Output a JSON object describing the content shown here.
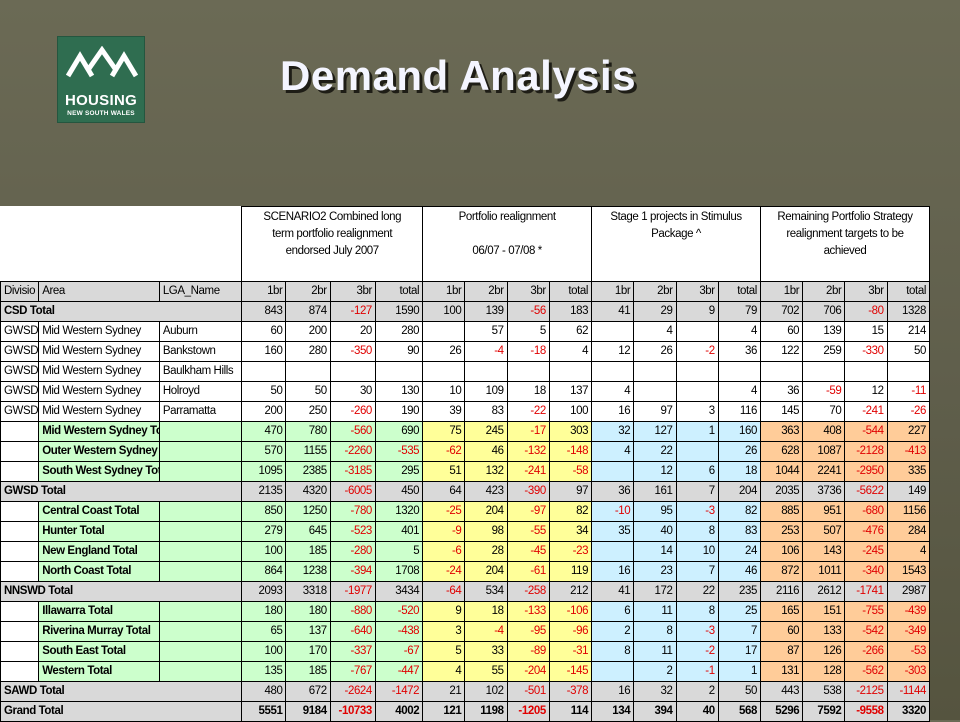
{
  "title": "Demand Analysis",
  "logo": {
    "line1": "HOUSING",
    "line2": "NEW SOUTH WALES",
    "icon": "mountain-roofs-icon",
    "color": "#2f6d50"
  },
  "table": {
    "group_headers": [
      "SCENARIO2        Combined long term portfolio realignment endorsed July 2007",
      "Portfolio realignment\n\n06/07 - 07/08 *",
      "Stage 1 projects in Stimulus Package ^",
      "Remaining Portfolio Strategy realignment targets to be achieved"
    ],
    "columns": [
      "Divisio",
      "Area",
      "LGA_Name",
      "1br",
      "2br",
      "3br",
      "total",
      "1br",
      "2br",
      "3br",
      "total",
      "1br",
      "2br",
      "3br",
      "total",
      "1br",
      "2br",
      "3br",
      "total"
    ],
    "rows": [
      {
        "style": "total",
        "div": "CSD Total",
        "area": "",
        "lga": "",
        "v": [
          "843",
          "874",
          "-127",
          "1590",
          "100",
          "139",
          "-56",
          "183",
          "41",
          "29",
          "9",
          "79",
          "702",
          "706",
          "-80",
          "1328"
        ]
      },
      {
        "style": "detail",
        "div": "GWSD",
        "area": "Mid Western Sydney",
        "lga": "Auburn",
        "v": [
          "60",
          "200",
          "20",
          "280",
          "",
          "57",
          "5",
          "62",
          "",
          "4",
          "",
          "4",
          "60",
          "139",
          "15",
          "214"
        ]
      },
      {
        "style": "detail",
        "div": "GWSD",
        "area": "Mid Western Sydney",
        "lga": "Bankstown",
        "v": [
          "160",
          "280",
          "-350",
          "90",
          "26",
          "-4",
          "-18",
          "4",
          "12",
          "26",
          "-2",
          "36",
          "122",
          "259",
          "-330",
          "50"
        ]
      },
      {
        "style": "detail",
        "div": "GWSD",
        "area": "Mid Western Sydney",
        "lga": "Baulkham Hills",
        "v": [
          "",
          "",
          "",
          "",
          "",
          "",
          "",
          "",
          "",
          "",
          "",
          "",
          "",
          "",
          "",
          ""
        ]
      },
      {
        "style": "detail",
        "div": "GWSD",
        "area": "Mid Western Sydney",
        "lga": "Holroyd",
        "v": [
          "50",
          "50",
          "30",
          "130",
          "10",
          "109",
          "18",
          "137",
          "4",
          "",
          "",
          "4",
          "36",
          "-59",
          "12",
          "-11"
        ]
      },
      {
        "style": "detail",
        "div": "GWSD",
        "area": "Mid Western Sydney",
        "lga": "Parramatta",
        "v": [
          "200",
          "250",
          "-260",
          "190",
          "39",
          "83",
          "-22",
          "100",
          "16",
          "97",
          "3",
          "116",
          "145",
          "70",
          "-241",
          "-26"
        ]
      },
      {
        "style": "area",
        "div": "",
        "area": "Mid Western Sydney Total",
        "lga": "",
        "v": [
          "470",
          "780",
          "-560",
          "690",
          "75",
          "245",
          "-17",
          "303",
          "32",
          "127",
          "1",
          "160",
          "363",
          "408",
          "-544",
          "227"
        ]
      },
      {
        "style": "area",
        "div": "",
        "area": "Outer Western Sydney Total",
        "lga": "",
        "v": [
          "570",
          "1155",
          "-2260",
          "-535",
          "-62",
          "46",
          "-132",
          "-148",
          "4",
          "22",
          "",
          "26",
          "628",
          "1087",
          "-2128",
          "-413"
        ]
      },
      {
        "style": "area",
        "div": "",
        "area": "South West Sydney Total",
        "lga": "",
        "v": [
          "1095",
          "2385",
          "-3185",
          "295",
          "51",
          "132",
          "-241",
          "-58",
          "",
          "12",
          "6",
          "18",
          "1044",
          "2241",
          "-2950",
          "335"
        ]
      },
      {
        "style": "total",
        "div": "GWSD Total",
        "area": "",
        "lga": "",
        "v": [
          "2135",
          "4320",
          "-6005",
          "450",
          "64",
          "423",
          "-390",
          "97",
          "36",
          "161",
          "7",
          "204",
          "2035",
          "3736",
          "-5622",
          "149"
        ]
      },
      {
        "style": "area",
        "div": "",
        "area": "Central Coast Total",
        "lga": "",
        "v": [
          "850",
          "1250",
          "-780",
          "1320",
          "-25",
          "204",
          "-97",
          "82",
          "-10",
          "95",
          "-3",
          "82",
          "885",
          "951",
          "-680",
          "1156"
        ]
      },
      {
        "style": "area",
        "div": "",
        "area": "Hunter Total",
        "lga": "",
        "v": [
          "279",
          "645",
          "-523",
          "401",
          "-9",
          "98",
          "-55",
          "34",
          "35",
          "40",
          "8",
          "83",
          "253",
          "507",
          "-476",
          "284"
        ]
      },
      {
        "style": "area",
        "div": "",
        "area": "New England Total",
        "lga": "",
        "v": [
          "100",
          "185",
          "-280",
          "5",
          "-6",
          "28",
          "-45",
          "-23",
          "",
          "14",
          "10",
          "24",
          "106",
          "143",
          "-245",
          "4"
        ]
      },
      {
        "style": "area",
        "div": "",
        "area": "North Coast Total",
        "lga": "",
        "v": [
          "864",
          "1238",
          "-394",
          "1708",
          "-24",
          "204",
          "-61",
          "119",
          "16",
          "23",
          "7",
          "46",
          "872",
          "1011",
          "-340",
          "1543"
        ]
      },
      {
        "style": "total",
        "div": "NNSWD Total",
        "area": "",
        "lga": "",
        "v": [
          "2093",
          "3318",
          "-1977",
          "3434",
          "-64",
          "534",
          "-258",
          "212",
          "41",
          "172",
          "22",
          "235",
          "2116",
          "2612",
          "-1741",
          "2987"
        ]
      },
      {
        "style": "area",
        "div": "",
        "area": "Illawarra Total",
        "lga": "",
        "v": [
          "180",
          "180",
          "-880",
          "-520",
          "9",
          "18",
          "-133",
          "-106",
          "6",
          "11",
          "8",
          "25",
          "165",
          "151",
          "-755",
          "-439"
        ]
      },
      {
        "style": "area",
        "div": "",
        "area": "Riverina Murray Total",
        "lga": "",
        "v": [
          "65",
          "137",
          "-640",
          "-438",
          "3",
          "-4",
          "-95",
          "-96",
          "2",
          "8",
          "-3",
          "7",
          "60",
          "133",
          "-542",
          "-349"
        ]
      },
      {
        "style": "area",
        "div": "",
        "area": "South East Total",
        "lga": "",
        "v": [
          "100",
          "170",
          "-337",
          "-67",
          "5",
          "33",
          "-89",
          "-31",
          "8",
          "11",
          "-2",
          "17",
          "87",
          "126",
          "-266",
          "-53"
        ]
      },
      {
        "style": "area",
        "div": "",
        "area": "Western Total",
        "lga": "",
        "v": [
          "135",
          "185",
          "-767",
          "-447",
          "4",
          "55",
          "-204",
          "-145",
          "",
          "2",
          "-1",
          "1",
          "131",
          "128",
          "-562",
          "-303"
        ]
      },
      {
        "style": "total",
        "div": "SAWD Total",
        "area": "",
        "lga": "",
        "v": [
          "480",
          "672",
          "-2624",
          "-1472",
          "21",
          "102",
          "-501",
          "-378",
          "16",
          "32",
          "2",
          "50",
          "443",
          "538",
          "-2125",
          "-1144"
        ]
      },
      {
        "style": "grand",
        "div": "Grand Total",
        "area": "",
        "lga": "",
        "v": [
          "5551",
          "9184",
          "-10733",
          "4002",
          "121",
          "1198",
          "-1205",
          "114",
          "134",
          "394",
          "40",
          "568",
          "5296",
          "7592",
          "-9558",
          "3320"
        ]
      }
    ]
  },
  "colors": {
    "total_row": "#d9d9d9",
    "area_total": "#ccffcc",
    "realign": "#ffff99",
    "stimulus": "#cdf0ff",
    "remaining": "#ffcc99",
    "negative": "#e00000"
  }
}
